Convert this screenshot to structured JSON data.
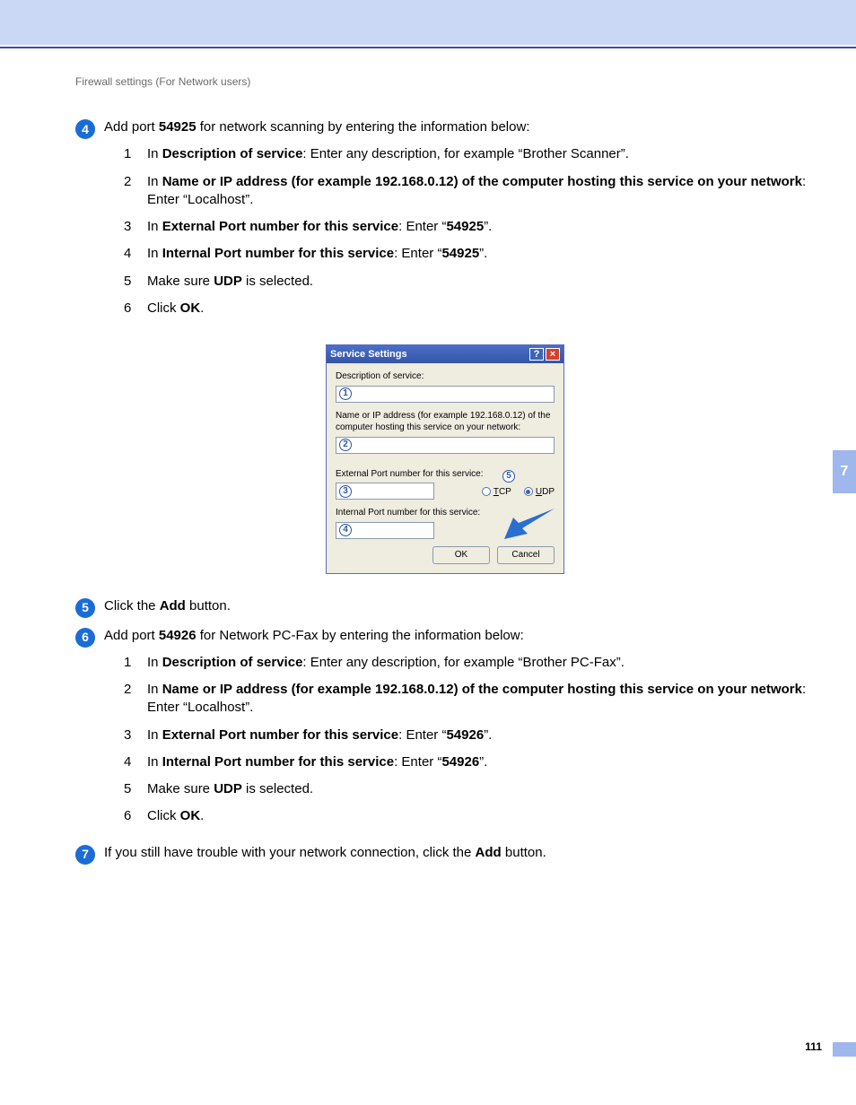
{
  "header": "Firewall settings (For Network users)",
  "sideTab": "7",
  "pageNum": "111",
  "step4": {
    "num": "4",
    "pre": "Add port ",
    "port": "54925",
    "post": " for network scanning by entering the information below:",
    "sub1": {
      "n": "1",
      "pre": "In ",
      "b": "Description of service",
      "post": ": Enter any description, for example “Brother Scanner”."
    },
    "sub2": {
      "n": "2",
      "pre": "In ",
      "b": "Name or IP address (for example 192.168.0.12) of the computer hosting this service on your network",
      "post": ": Enter “Localhost”."
    },
    "sub3": {
      "n": "3",
      "pre": "In ",
      "b": "External Port number for this service",
      "post1": ": Enter “",
      "val": "54925",
      "post2": "”."
    },
    "sub4": {
      "n": "4",
      "pre": "In ",
      "b": "Internal Port number for this service",
      "post1": ": Enter “",
      "val": "54925",
      "post2": "”."
    },
    "sub5": {
      "n": "5",
      "pre": "Make sure ",
      "b": "UDP",
      "post": " is selected."
    },
    "sub6": {
      "n": "6",
      "pre": "Click ",
      "b": "OK",
      "post": "."
    }
  },
  "dialog": {
    "title": "Service Settings",
    "desc": "Description of service:",
    "ip": "Name or IP address (for example 192.168.0.12) of the computer hosting this service on your network:",
    "ext": "External Port number for this service:",
    "int": "Internal Port number for this service:",
    "tcp": "TCP",
    "udp": "UDP",
    "tcpU": "T",
    "udpU": "U",
    "ok": "OK",
    "cancel": "Cancel",
    "c1": "1",
    "c2": "2",
    "c3": "3",
    "c4": "4",
    "c5": "5"
  },
  "step5": {
    "num": "5",
    "pre": "Click the ",
    "b": "Add",
    "post": " button."
  },
  "step6": {
    "num": "6",
    "pre": "Add port ",
    "port": "54926",
    "post": " for Network PC-Fax by entering the information below:",
    "sub1": {
      "n": "1",
      "pre": "In ",
      "b": "Description of service",
      "post": ": Enter any description, for example “Brother PC-Fax”."
    },
    "sub2": {
      "n": "2",
      "pre": "In ",
      "b": "Name or IP address (for example 192.168.0.12) of the computer hosting this service on your network",
      "post": ": Enter “Localhost”."
    },
    "sub3": {
      "n": "3",
      "pre": "In ",
      "b": "External Port number for this service",
      "post1": ": Enter “",
      "val": "54926",
      "post2": "”."
    },
    "sub4": {
      "n": "4",
      "pre": "In ",
      "b": "Internal Port number for this service",
      "post1": ": Enter “",
      "val": "54926",
      "post2": "”."
    },
    "sub5": {
      "n": "5",
      "pre": "Make sure ",
      "b": "UDP",
      "post": " is selected."
    },
    "sub6": {
      "n": "6",
      "pre": "Click ",
      "b": "OK",
      "post": "."
    }
  },
  "step7": {
    "num": "7",
    "pre": "If you still have trouble with your network connection, click the ",
    "b": "Add",
    "post": " button."
  }
}
